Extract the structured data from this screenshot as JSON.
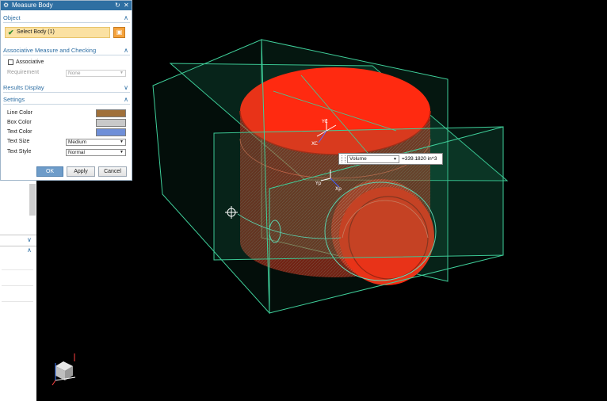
{
  "dialog": {
    "title": "Measure Body",
    "sections": {
      "object": "Object",
      "associative": "Associative Measure and Checking",
      "results": "Results Display",
      "settings": "Settings"
    },
    "select_body": "Select Body (1)",
    "associative_label": "Associative",
    "associative_checked": false,
    "requirement_label": "Requirement",
    "requirement_value": "None",
    "settings": {
      "line_color_label": "Line Color",
      "line_color": "#a0703a",
      "box_color_label": "Box Color",
      "box_color": "#c9c9c9",
      "text_color_label": "Text Color",
      "text_color": "#6f8fd8",
      "text_size_label": "Text Size",
      "text_size_value": "Medium",
      "text_style_label": "Text Style",
      "text_style_value": "Normal"
    },
    "buttons": {
      "ok": "OK",
      "apply": "Apply",
      "cancel": "Cancel"
    }
  },
  "callout": {
    "measure_type": "Volume",
    "value": "=339.1820 in^3"
  },
  "triad": {
    "yc": "YC",
    "xc": "XC",
    "yp": "Yp",
    "xp": "Xp"
  },
  "colors": {
    "background": "#000000",
    "body": "#ff2a10",
    "plane_edge": "#3fcf9a",
    "titlebar": "#2f6fa2",
    "section_text": "#2d6ea3"
  }
}
